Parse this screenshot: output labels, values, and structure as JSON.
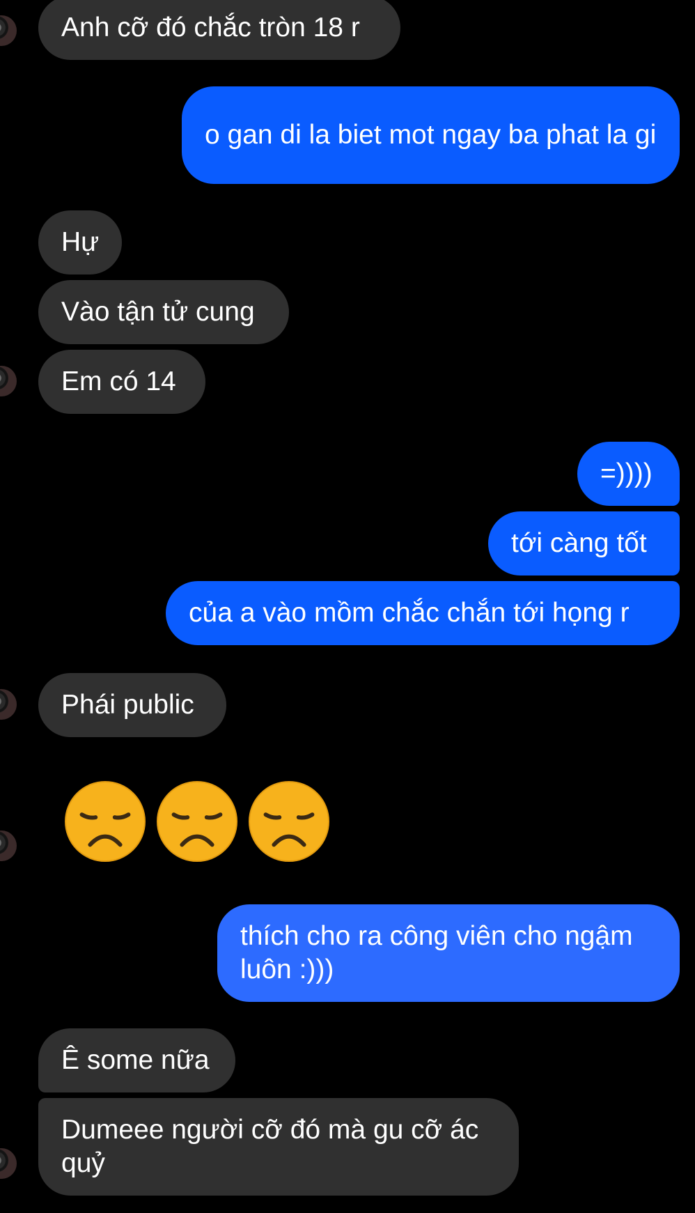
{
  "messages": [
    {
      "side": "received",
      "text": "Anh cỡ đó chắc tròn 18 r"
    },
    {
      "side": "sent",
      "text": "o gan di la biet mot ngay ba phat la gi"
    },
    {
      "side": "received",
      "text": "Hự"
    },
    {
      "side": "received",
      "text": "Vào tận tử cung"
    },
    {
      "side": "received",
      "text": "Em có 14"
    },
    {
      "side": "sent",
      "text": "=))))"
    },
    {
      "side": "sent",
      "text": "tới càng tốt"
    },
    {
      "side": "sent",
      "text": "của a vào mồm chắc chắn tới họng r"
    },
    {
      "side": "received",
      "text": "Phái public"
    },
    {
      "side": "received",
      "type": "emoji",
      "emoji": [
        "disappointed-face-icon",
        "disappointed-face-icon",
        "disappointed-face-icon"
      ]
    },
    {
      "side": "sent",
      "text": "thích cho ra công viên cho ngậm luôn :)))"
    },
    {
      "side": "received",
      "text": "Ê some nữa"
    },
    {
      "side": "received",
      "text": "Dumeee người cỡ đó mà gu cỡ ác quỷ"
    }
  ],
  "colors": {
    "background": "#000000",
    "received_bubble": "#303030",
    "sent_bubble": "#0a5cff",
    "sent_bubble_alt": "#2d6bff",
    "emoji_yellow": "#f7b21c"
  }
}
